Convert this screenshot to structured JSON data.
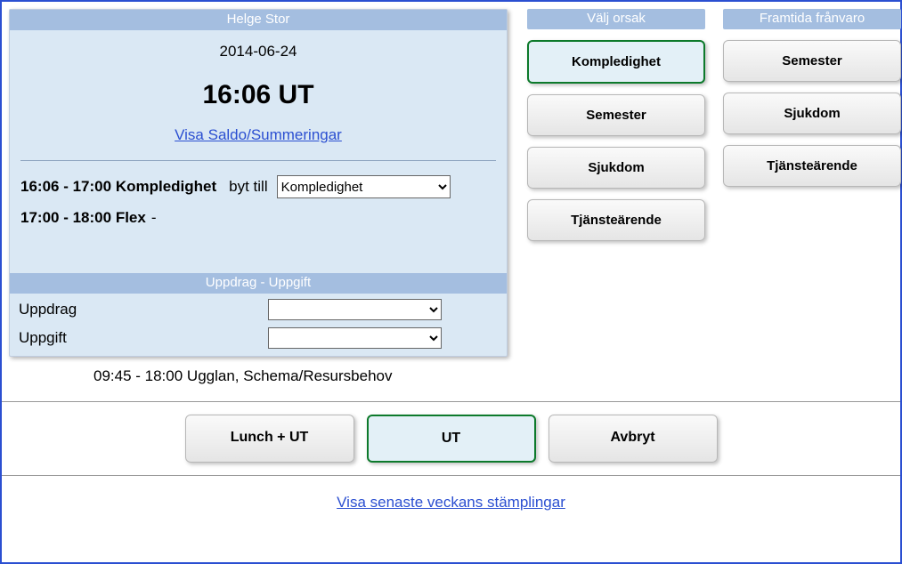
{
  "left": {
    "title": "Helge Stor",
    "date": "2014-06-24",
    "time": "16:06 UT",
    "saldo_link": "Visa Saldo/Summeringar",
    "row1": {
      "time": "16:06 - 17:00",
      "type": "Kompledighet",
      "byt_label": "byt till",
      "select_value": "Kompledighet"
    },
    "row2": {
      "time": "17:00 - 18:00",
      "type": "Flex"
    },
    "subheader": "Uppdrag - Uppgift",
    "field1_label": "Uppdrag",
    "field2_label": "Uppgift"
  },
  "schedule_line": "09:45 - 18:00 Ugglan, Schema/Resursbehov",
  "reason": {
    "header": "Välj orsak",
    "options": [
      "Kompledighet",
      "Semester",
      "Sjukdom",
      "Tjänsteärende"
    ],
    "selected_index": 0
  },
  "future": {
    "header": "Framtida frånvaro",
    "options": [
      "Semester",
      "Sjukdom",
      "Tjänsteärende"
    ]
  },
  "actions": {
    "lunch": "Lunch + UT",
    "ut": "UT",
    "cancel": "Avbryt"
  },
  "bottom_link": "Visa senaste veckans stämplingar"
}
